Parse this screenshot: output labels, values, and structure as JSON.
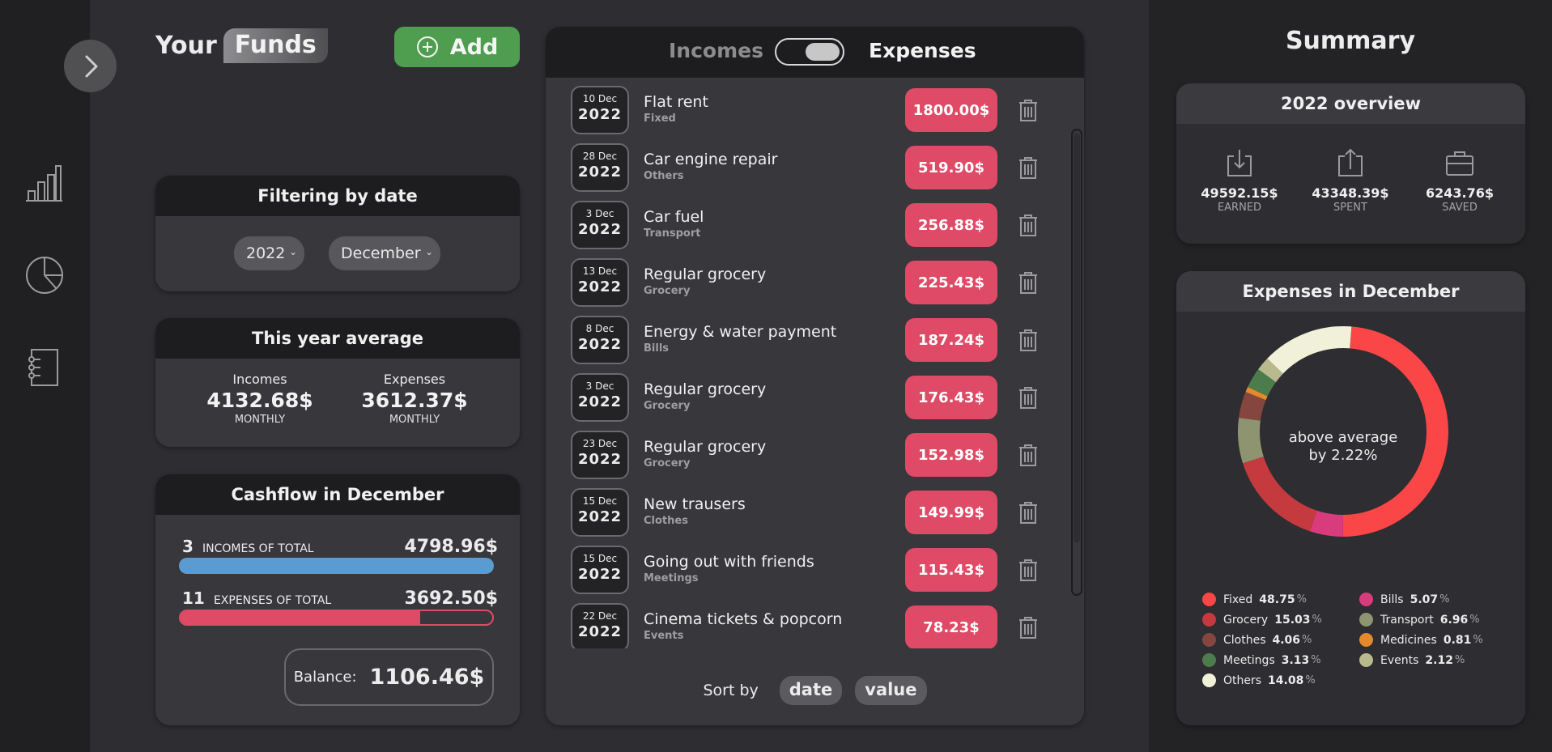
{
  "header": {
    "title_your": "Your",
    "title_funds": "Funds",
    "add_label": "Add"
  },
  "filter": {
    "title": "Filtering by date",
    "year": "2022",
    "month": "December"
  },
  "average": {
    "title": "This year average",
    "incomes_label": "Incomes",
    "incomes_value": "4132.68$",
    "expenses_label": "Expenses",
    "expenses_value": "3612.37$",
    "period": "MONTHLY"
  },
  "cashflow": {
    "title": "Cashflow in December",
    "incomes_count": "3",
    "incomes_label": "INCOMES OF TOTAL",
    "incomes_total": "4798.96$",
    "expenses_count": "11",
    "expenses_label": "EXPENSES OF TOTAL",
    "expenses_total": "3692.50$",
    "incomes_fill": 1.0,
    "expenses_fill": 0.77,
    "balance_label": "Balance:",
    "balance_value": "1106.46$"
  },
  "list": {
    "tab_incomes": "Incomes",
    "tab_expenses": "Expenses",
    "items": [
      {
        "day": "10 Dec",
        "year": "2022",
        "name": "Flat rent",
        "category": "Fixed",
        "amount": "1800.00$"
      },
      {
        "day": "28 Dec",
        "year": "2022",
        "name": "Car engine repair",
        "category": "Others",
        "amount": "519.90$"
      },
      {
        "day": "3 Dec",
        "year": "2022",
        "name": "Car fuel",
        "category": "Transport",
        "amount": "256.88$"
      },
      {
        "day": "13 Dec",
        "year": "2022",
        "name": "Regular grocery",
        "category": "Grocery",
        "amount": "225.43$"
      },
      {
        "day": "8 Dec",
        "year": "2022",
        "name": "Energy & water payment",
        "category": "Bills",
        "amount": "187.24$"
      },
      {
        "day": "3 Dec",
        "year": "2022",
        "name": "Regular grocery",
        "category": "Grocery",
        "amount": "176.43$"
      },
      {
        "day": "23 Dec",
        "year": "2022",
        "name": "Regular grocery",
        "category": "Grocery",
        "amount": "152.98$"
      },
      {
        "day": "15 Dec",
        "year": "2022",
        "name": "New trausers",
        "category": "Clothes",
        "amount": "149.99$"
      },
      {
        "day": "15 Dec",
        "year": "2022",
        "name": "Going out with friends",
        "category": "Meetings",
        "amount": "115.43$"
      },
      {
        "day": "22 Dec",
        "year": "2022",
        "name": "Cinema tickets & popcorn",
        "category": "Events",
        "amount": "78.23$"
      }
    ],
    "sort_label": "Sort by",
    "sort_date": "date",
    "sort_value": "value"
  },
  "summary": {
    "title": "Summary",
    "overview_title": "2022 overview",
    "earned_value": "49592.15$",
    "earned_label": "EARNED",
    "spent_value": "43348.39$",
    "spent_label": "SPENT",
    "saved_value": "6243.76$",
    "saved_label": "SAVED",
    "expenses_title": "Expenses in December",
    "center_line1": "above average",
    "center_line2": "by 2.22%"
  },
  "chart_data": {
    "type": "pie",
    "title": "Expenses in December",
    "categories": [
      "Fixed",
      "Bills",
      "Grocery",
      "Transport",
      "Clothes",
      "Medicines",
      "Meetings",
      "Events",
      "Others"
    ],
    "values": [
      48.75,
      5.07,
      15.03,
      6.96,
      4.06,
      0.81,
      3.13,
      2.12,
      14.08
    ],
    "colors": [
      "#fa4646",
      "#d93c7d",
      "#c43a3f",
      "#8e9470",
      "#84463e",
      "#e48a2c",
      "#4c7c4c",
      "#b9b98e",
      "#f0f1d8"
    ],
    "unit": "%"
  },
  "colors": {
    "accent_green": "#4f9d4f",
    "expense_red": "#df4a66",
    "income_blue": "#5a9bd1"
  },
  "icons": {
    "expand": "chevron-right-icon",
    "bar_chart": "bar-chart-icon",
    "pie_chart": "pie-chart-icon",
    "notebook": "notebook-icon",
    "add": "plus-circle-icon",
    "trash": "trash-icon",
    "earned": "download-icon",
    "spent": "upload-icon",
    "saved": "briefcase-icon"
  }
}
